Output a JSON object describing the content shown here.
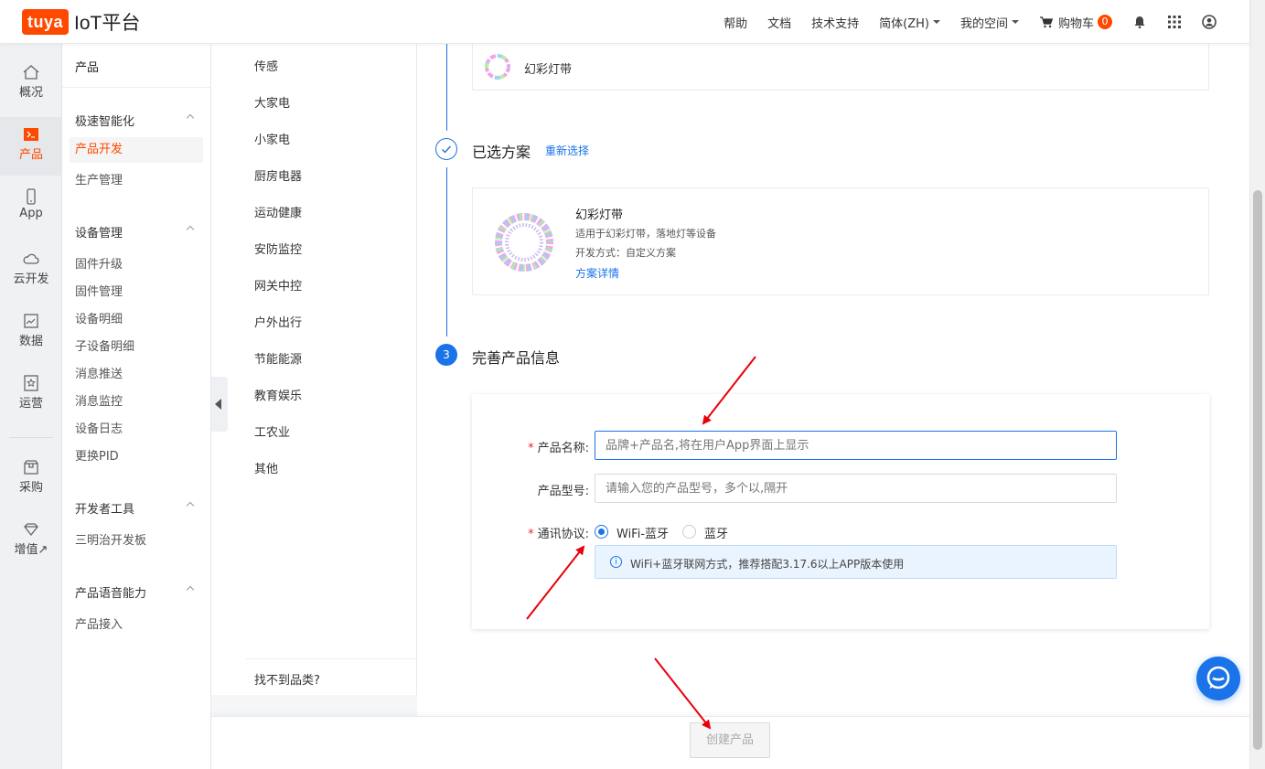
{
  "brand": {
    "logo": "tuya",
    "title": "IoT平台",
    "color": "#ff4800"
  },
  "topnav": {
    "help": "帮助",
    "docs": "文档",
    "support": "技术支持",
    "lang": "简体(ZH)",
    "space": "我的空间",
    "cart": "购物车",
    "cart_count": "0"
  },
  "leftnav": [
    {
      "label": "概况",
      "icon": "home-icon"
    },
    {
      "label": "产品",
      "icon": "terminal-icon",
      "active": true
    },
    {
      "label": "App",
      "icon": "phone-icon"
    },
    {
      "label": "云开发",
      "icon": "cloud-icon"
    },
    {
      "label": "数据",
      "icon": "chart-icon"
    },
    {
      "label": "运营",
      "icon": "star-board-icon"
    },
    {
      "label": "采购",
      "icon": "box-icon"
    },
    {
      "label": "增值↗",
      "icon": "diamond-icon"
    }
  ],
  "subnav": {
    "head": "产品",
    "groups": [
      {
        "title": "极速智能化",
        "items": [
          "产品开发",
          "生产管理"
        ]
      },
      {
        "title": "设备管理",
        "items": [
          "固件升级",
          "固件管理",
          "设备明细",
          "子设备明细",
          "消息推送",
          "消息监控",
          "设备日志",
          "更换PID"
        ]
      },
      {
        "title": "开发者工具",
        "items": [
          "三明治开发板"
        ]
      },
      {
        "title": "产品语音能力",
        "items": [
          "产品接入"
        ]
      }
    ]
  },
  "categories": [
    "传感",
    "大家电",
    "小家电",
    "厨房电器",
    "运动健康",
    "安防监控",
    "网关中控",
    "户外出行",
    "节能能源",
    "教育娱乐",
    "工农业",
    "其他"
  ],
  "category_footer": "找不到品类?",
  "top_card": {
    "label": "幻彩灯带"
  },
  "selected": {
    "title": "已选方案",
    "reselect": "重新选择",
    "name": "幻彩灯带",
    "desc": "适用于幻彩灯带，落地灯等设备",
    "method": "开发方式：自定义方案",
    "detail": "方案详情"
  },
  "step3": {
    "num": "3",
    "title": "完善产品信息",
    "name_label": "产品名称:",
    "name_placeholder": "品牌+产品名,将在用户App界面上显示",
    "model_label": "产品型号:",
    "model_placeholder": "请输入您的产品型号，多个以,隔开",
    "protocol_label": "通讯协议:",
    "protocol_options": [
      "WiFi-蓝牙",
      "蓝牙"
    ],
    "protocol_selected": "WiFi-蓝牙",
    "info": "WiFi+蓝牙联网方式，推荐搭配3.17.6以上APP版本使用"
  },
  "create_button": "创建产品",
  "colors": {
    "accent": "#1a73e8",
    "brand": "#ff4800",
    "arrow": "#e8000b",
    "required": "#f5222d"
  }
}
